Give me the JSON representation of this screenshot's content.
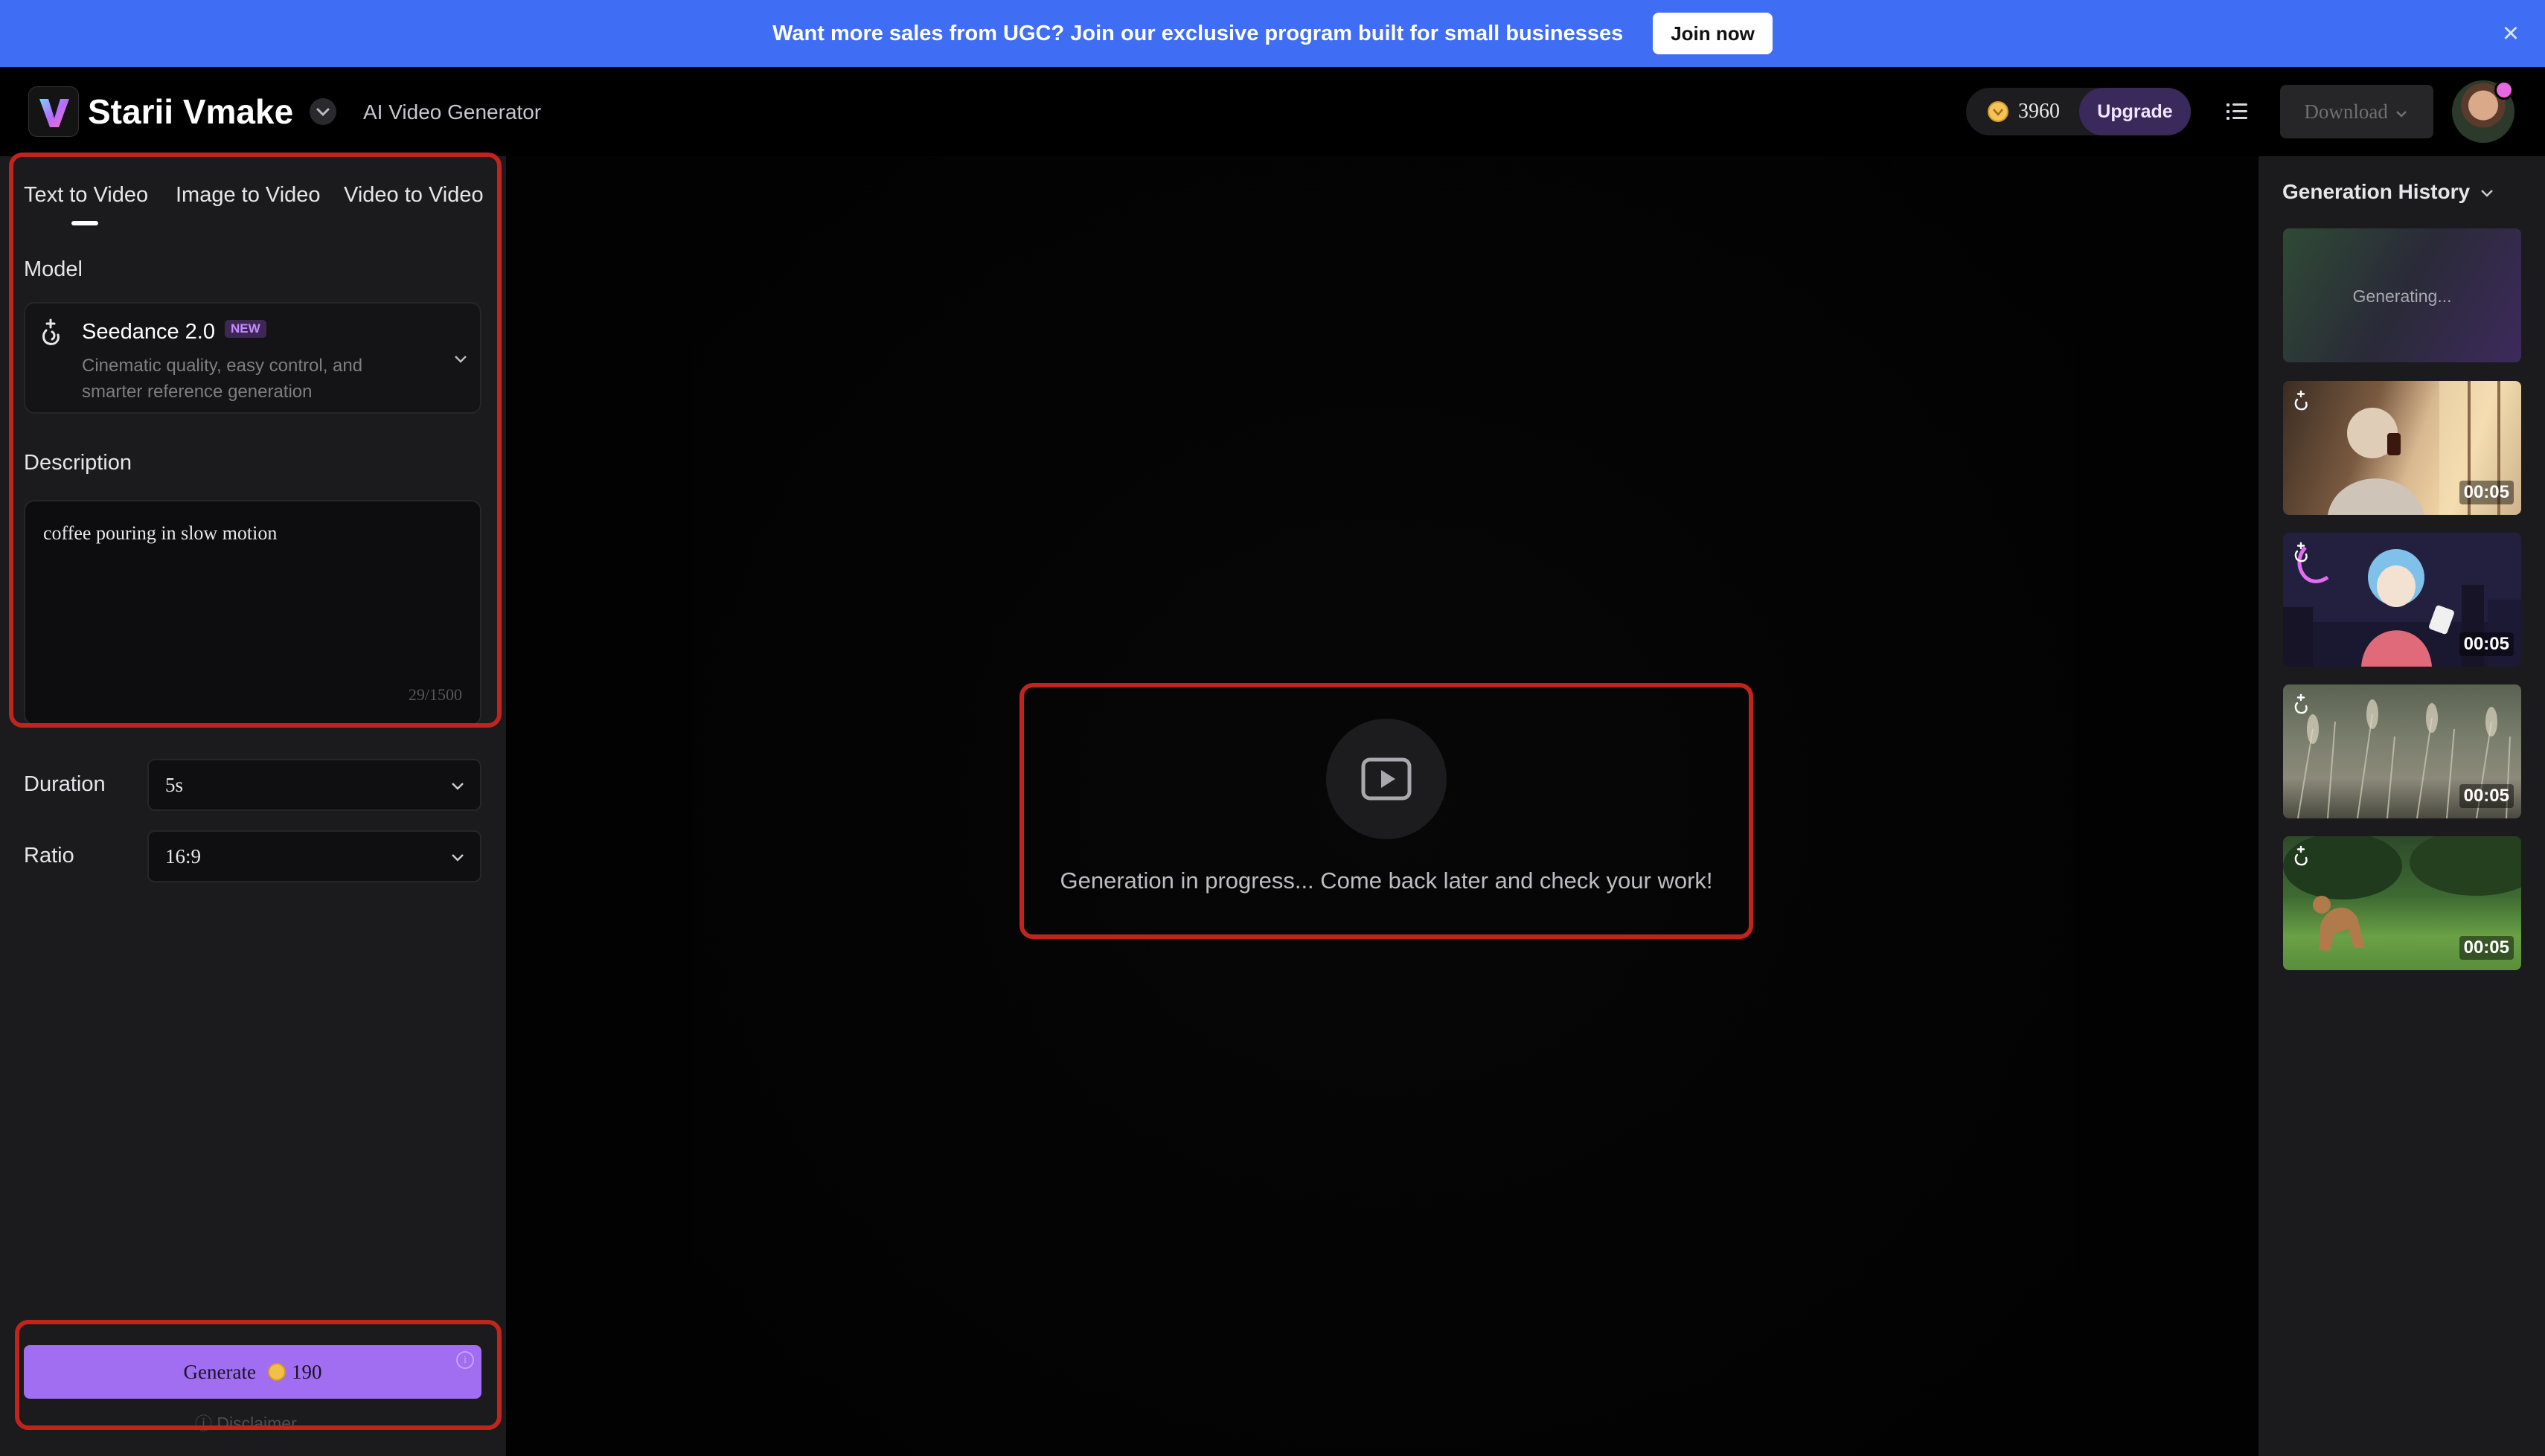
{
  "banner": {
    "text": "Want more sales from UGC? Join our exclusive program built for small businesses",
    "cta": "Join now",
    "close_icon": "close-icon"
  },
  "header": {
    "app_name": "Starii Vmake",
    "app_subtitle": "AI Video Generator",
    "credits": "3960",
    "upgrade_label": "Upgrade",
    "download_label": "Download"
  },
  "left_panel": {
    "tabs": [
      {
        "label": "Text to Video",
        "active": true
      },
      {
        "label": "Image to Video",
        "active": false
      },
      {
        "label": "Video to Video",
        "active": false
      }
    ],
    "model_label": "Model",
    "model": {
      "name": "Seedance 2.0",
      "badge": "NEW",
      "description": "Cinematic quality, easy control, and smarter reference generation"
    },
    "description_label": "Description",
    "description": {
      "value": "coffee pouring in slow motion",
      "counter": "29/1500"
    },
    "duration": {
      "label": "Duration",
      "value": "5s"
    },
    "ratio": {
      "label": "Ratio",
      "value": "16:9"
    },
    "generate": {
      "label": "Generate",
      "cost": "190"
    },
    "disclaimer": "Disclaimer"
  },
  "center": {
    "message": "Generation in progress... Come back later and check your work!"
  },
  "history": {
    "title": "Generation History",
    "generating_label": "Generating...",
    "items": [
      {
        "duration": "00:05"
      },
      {
        "duration": "00:05"
      },
      {
        "duration": "00:05"
      },
      {
        "duration": "00:05"
      }
    ]
  },
  "colors": {
    "banner": "#3f6df3",
    "accent": "#a16ef2",
    "highlight_frame": "#c0241c",
    "panel": "#1b1b1e"
  }
}
